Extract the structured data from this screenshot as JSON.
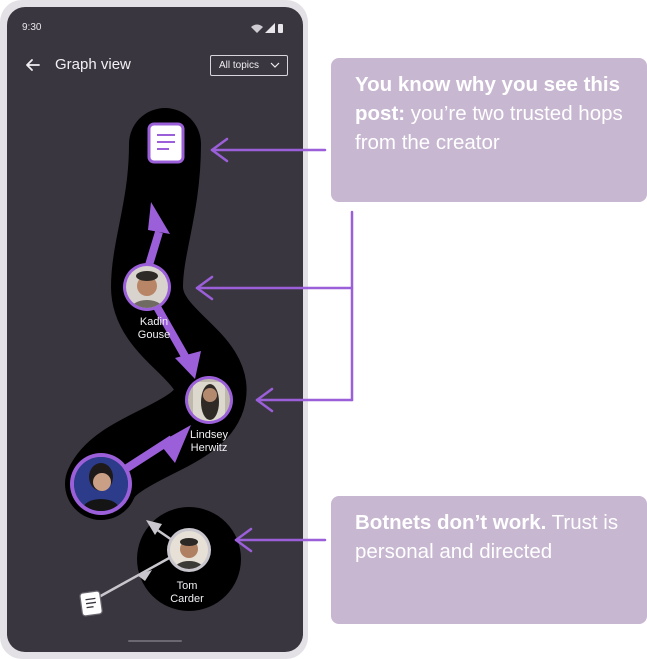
{
  "status_bar": {
    "time": "9:30"
  },
  "app_bar": {
    "title": "Graph view",
    "filter_value": "All topics"
  },
  "nodes": [
    {
      "name": "Kadin Gouse",
      "line1": "Kadin",
      "line2": "Gouse"
    },
    {
      "name": "Lindsey Herwitz",
      "line1": "Lindsey",
      "line2": "Herwitz"
    },
    {
      "name": "Tom Carder",
      "line1": "Tom",
      "line2": "Carder"
    }
  ],
  "callouts": {
    "top": {
      "bold": "You know why you see this post:",
      "rest": " you’re two trusted hops from the creator"
    },
    "bottom": {
      "bold": "Botnets don’t work.",
      "rest": " Trust is personal and directed"
    }
  },
  "colors": {
    "accent": "#9b5fd9",
    "callout_bg": "#c7b7d1",
    "screen_bg": "#3a363f"
  },
  "icons": [
    "back-arrow-icon",
    "chevron-down-icon",
    "post-document-icon",
    "wifi-icon",
    "signal-icon",
    "battery-icon"
  ]
}
